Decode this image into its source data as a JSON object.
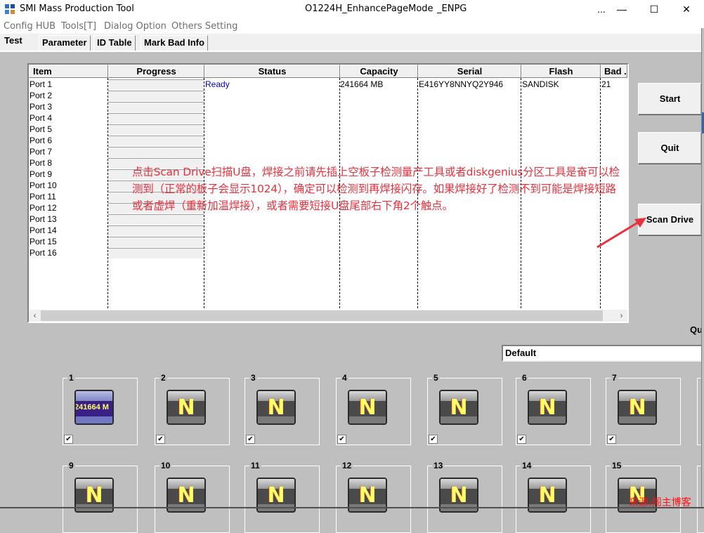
{
  "window": {
    "title": "SMI Mass Production Tool",
    "subtitle": "O1224H_EnhancePageMode",
    "mode": "_ENPG",
    "more_label": "...",
    "minimize_label": "—",
    "maximize_label": "☐",
    "close_label": "✕"
  },
  "menu": [
    {
      "label": "Config HUB"
    },
    {
      "label": "Tools[T]"
    },
    {
      "label": "Dialog Option"
    },
    {
      "label": "Others Setting"
    }
  ],
  "tabs": [
    {
      "label": "Test",
      "active": true
    },
    {
      "label": "Parameter"
    },
    {
      "label": "ID Table"
    },
    {
      "label": "Mark Bad Info"
    }
  ],
  "table": {
    "columns": [
      "Item",
      "Progress",
      "Status",
      "Capacity",
      "Serial",
      "Flash",
      "Bad ."
    ],
    "rows": [
      {
        "item": "Port 1",
        "status": "Ready",
        "capacity": "241664 MB",
        "serial": "E416YY8NNYQ2Y946",
        "flash": "SANDISK",
        "bad": "21"
      },
      {
        "item": "Port 2"
      },
      {
        "item": "Port 3"
      },
      {
        "item": "Port 4"
      },
      {
        "item": "Port 5"
      },
      {
        "item": "Port 6"
      },
      {
        "item": "Port 7"
      },
      {
        "item": "Port 8"
      },
      {
        "item": "Port 9"
      },
      {
        "item": "Port 10"
      },
      {
        "item": "Port 11"
      },
      {
        "item": "Port 12"
      },
      {
        "item": "Port 13"
      },
      {
        "item": "Port 14"
      },
      {
        "item": "Port 15"
      },
      {
        "item": "Port 16"
      }
    ],
    "scroll_left": "‹",
    "scroll_right": "›"
  },
  "buttons": {
    "start": "Start",
    "quit": "Quit",
    "scan_drive": "Scan Drive"
  },
  "annotation": "点击Scan Drive扫描U盘，焊接之前请先插上空板子检测量产工具或者diskgenius分区工具是奋可以检测到（正常的板子会显示1024），确定可以检测到再焊接闪存。如果焊接好了检测不到可能是焊接短路或者虚焊（重新加温焊接），或者需要短接U盘尾部右下角2个触点。",
  "q_label": "Qu",
  "default_field": "Default",
  "ports": [
    {
      "num": "1",
      "state": "active",
      "label": "241664 M",
      "checked": true
    },
    {
      "num": "2",
      "state": "N",
      "checked": true
    },
    {
      "num": "3",
      "state": "N",
      "checked": true
    },
    {
      "num": "4",
      "state": "N",
      "checked": true
    },
    {
      "num": "5",
      "state": "N",
      "checked": true
    },
    {
      "num": "6",
      "state": "N",
      "checked": true
    },
    {
      "num": "7",
      "state": "N",
      "checked": true
    },
    {
      "num": "9",
      "state": "N"
    },
    {
      "num": "10",
      "state": "N"
    },
    {
      "num": "11",
      "state": "N"
    },
    {
      "num": "12",
      "state": "N"
    },
    {
      "num": "13",
      "state": "N"
    },
    {
      "num": "14",
      "state": "N"
    },
    {
      "num": "15",
      "state": "N"
    }
  ],
  "checkmark": "✔",
  "watermark": "来源:阁主博客",
  "colors": {
    "status_ready": "#0000c0",
    "annotation": "#e8313d",
    "watermark": "#ff1010"
  }
}
